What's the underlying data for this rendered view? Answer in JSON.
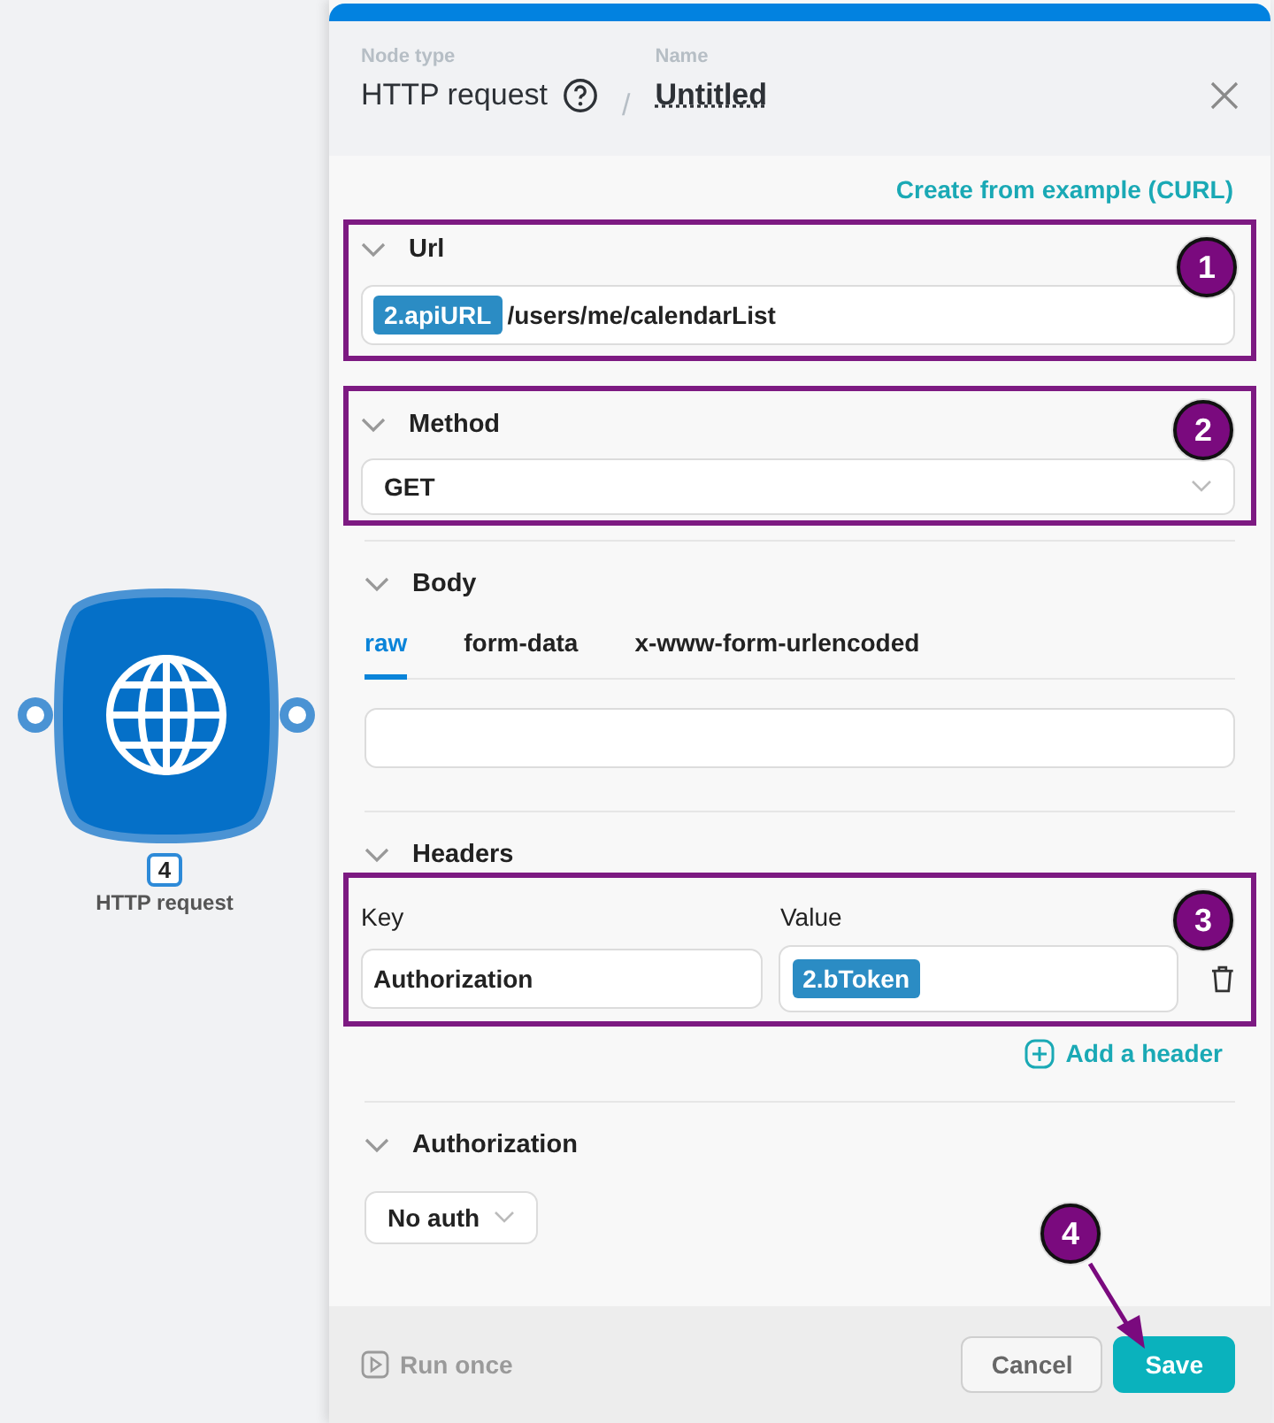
{
  "node": {
    "label": "HTTP request",
    "badge": "4"
  },
  "header": {
    "node_type_label": "Node type",
    "node_type": "HTTP request",
    "separator": "/",
    "name_label": "Name",
    "name": "Untitled"
  },
  "create_link": "Create from example (CURL)",
  "url": {
    "title": "Url",
    "token": "2.apiURL",
    "path": "/users/me/calendarList",
    "callout": "1"
  },
  "method": {
    "title": "Method",
    "value": "GET",
    "callout": "2"
  },
  "body": {
    "title": "Body",
    "tabs": [
      {
        "label": "raw",
        "selected": true
      },
      {
        "label": "form-data",
        "selected": false
      },
      {
        "label": "x-www-form-urlencoded",
        "selected": false
      }
    ]
  },
  "headers": {
    "title": "Headers",
    "key_label": "Key",
    "value_label": "Value",
    "callout": "3",
    "rows": [
      {
        "key": "Authorization",
        "value_token": "2.bToken"
      }
    ],
    "add_label": "Add a header"
  },
  "authorization": {
    "title": "Authorization",
    "value": "No auth"
  },
  "footer": {
    "run_once": "Run once",
    "cancel": "Cancel",
    "save": "Save",
    "callout": "4"
  }
}
